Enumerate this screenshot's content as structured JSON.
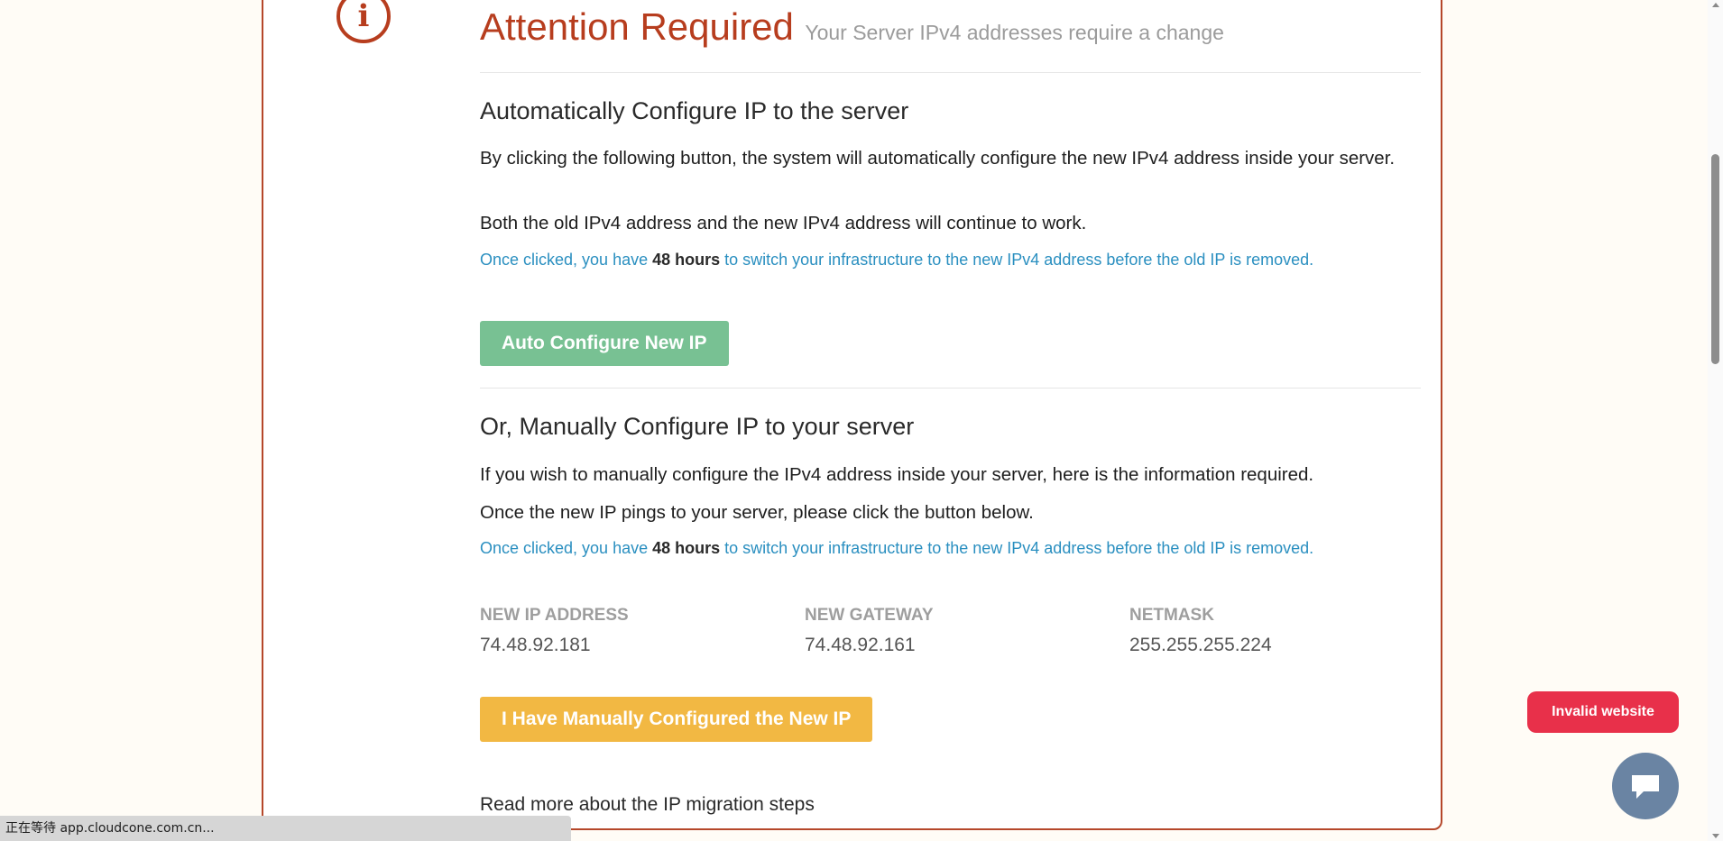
{
  "header": {
    "title": "Attention Required",
    "subtitle": "Your Server IPv4 addresses require a change"
  },
  "auto_section": {
    "heading": "Automatically Configure IP to the server",
    "para1": "By clicking the following button, the system will automatically configure the new IPv4 address inside your server.",
    "para2": "Both the old IPv4 address and the new IPv4 address will continue to work.",
    "note_prefix": "Once clicked, you have ",
    "note_bold": "48 hours",
    "note_suffix": " to switch your infrastructure to the new IPv4 address before the old IP is removed.",
    "button_label": "Auto Configure New IP"
  },
  "manual_section": {
    "heading": "Or, Manually Configure IP to your server",
    "para1": "If you wish to manually configure the IPv4 address inside your server, here is the information required.",
    "para2": "Once the new IP pings to your server, please click the button below.",
    "note_prefix": "Once clicked, you have ",
    "note_bold": "48 hours",
    "note_suffix": " to switch your infrastructure to the new IPv4 address before the old IP is removed.",
    "ip_info": [
      {
        "label": "NEW IP ADDRESS",
        "value": "74.48.92.181"
      },
      {
        "label": "NEW GATEWAY",
        "value": "74.48.92.161"
      },
      {
        "label": "NETMASK",
        "value": "255.255.255.224"
      }
    ],
    "button_label": "I Have Manually Configured the New IP",
    "read_more": "Read more about the IP migration steps"
  },
  "overlay": {
    "invalid_badge": "Invalid website",
    "chat_icon": "chat-bubble-icon"
  },
  "status_bar": {
    "text": "正在等待 app.cloudcone.com.cn..."
  },
  "colors": {
    "accent": "#b73d1e",
    "note_blue": "#2a8fc0",
    "button_green": "#78c193",
    "button_yellow": "#f2b843",
    "badge_red": "#e8304a"
  }
}
